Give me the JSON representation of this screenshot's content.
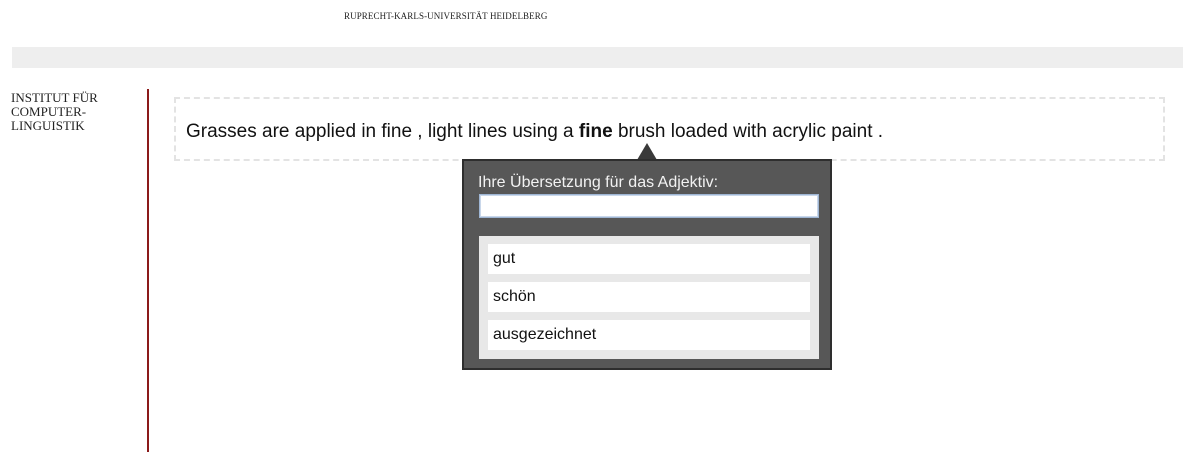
{
  "header": {
    "university": "RUPRECHT-KARLS-UNIVERSITÄT HEIDELBERG"
  },
  "sidebar": {
    "institute_lines": [
      "INSTITUT FÜR",
      "COMPUTER-",
      "LINGUISTIK"
    ]
  },
  "sentence": {
    "before": "Grasses are applied in fine , light lines using a ",
    "highlight": "fine",
    "after": " brush loaded with acrylic paint ."
  },
  "popup": {
    "label": "Ihre Übersetzung für das Adjektiv:",
    "input_value": "",
    "options": [
      "gut",
      "schön",
      "ausgezeichnet"
    ]
  },
  "colors": {
    "accent_rule": "#8b1a1a",
    "popup_bg": "#575757"
  }
}
